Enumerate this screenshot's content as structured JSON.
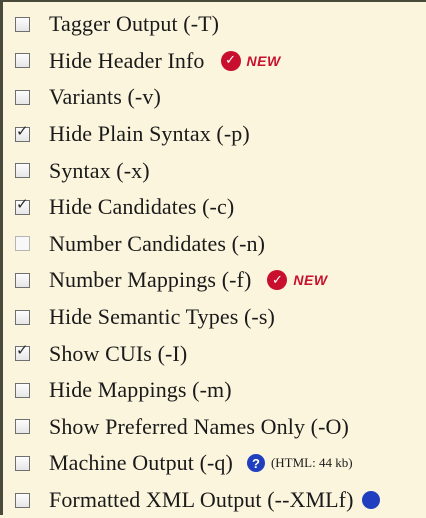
{
  "options": [
    {
      "label": "Tagger Output (-T)",
      "checked": false
    },
    {
      "label": "Hide Header Info",
      "checked": false,
      "badge": "NEW"
    },
    {
      "label": "Variants (-v)",
      "checked": false
    },
    {
      "label": "Hide Plain Syntax (-p)",
      "checked": true
    },
    {
      "label": "Syntax (-x)",
      "checked": false
    },
    {
      "label": "Hide Candidates (-c)",
      "checked": true
    },
    {
      "label": "Number Candidates (-n)",
      "checked": false,
      "disabled": true
    },
    {
      "label": "Number Mappings (-f)",
      "checked": false,
      "badge": "NEW"
    },
    {
      "label": "Hide Semantic Types (-s)",
      "checked": false
    },
    {
      "label": "Show CUIs (-I)",
      "checked": true
    },
    {
      "label": "Hide Mappings (-m)",
      "checked": false
    },
    {
      "label": "Show Preferred Names Only (-O)",
      "checked": false
    },
    {
      "label": "Machine Output (-q)",
      "checked": false,
      "help": "?",
      "html_size": "(HTML: 44 kb)"
    },
    {
      "label": "Formatted XML Output (--XMLf)",
      "checked": false
    }
  ],
  "icons": {
    "checkmark": "check-icon",
    "new_badge": "new-badge-icon",
    "help": "help-icon"
  },
  "colors": {
    "background": "#fbf5dd",
    "badge_red": "#c8102e",
    "help_blue": "#1f3fbf"
  }
}
